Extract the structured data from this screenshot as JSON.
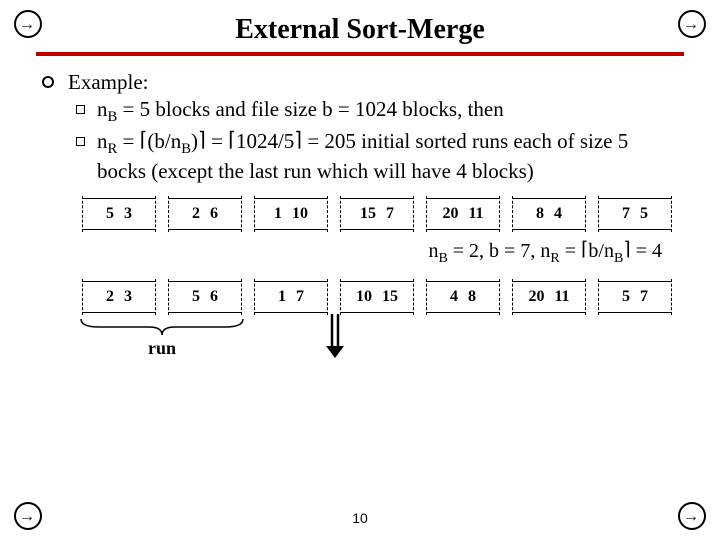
{
  "title": "External Sort-Merge",
  "page_number": "10",
  "example_label": "Example:",
  "bullet1_pre": "n",
  "bullet1_sub": "B",
  "bullet1_post": " = 5 blocks and file size b = 1024 blocks, then",
  "bullet2_nr_pre": "n",
  "bullet2_nr_sub": "R",
  "bullet2_eq1": " = ",
  "bullet2_frac_pre": "(b/n",
  "bullet2_frac_sub": "B",
  "bullet2_frac_post": ")",
  "bullet2_eq2": " = ",
  "bullet2_val": "1024/5",
  "bullet2_tail": " = 205 initial sorted runs each of size 5 bocks (except the last run which will have 4 blocks)",
  "ceil_l": "⌈",
  "ceil_r": "⌉",
  "row1": [
    [
      "5",
      "3"
    ],
    [
      "2",
      "6"
    ],
    [
      "1",
      "10"
    ],
    [
      "15",
      "7"
    ],
    [
      "20",
      "11"
    ],
    [
      "8",
      "4"
    ],
    [
      "7",
      "5"
    ]
  ],
  "row2": [
    [
      "2",
      "3"
    ],
    [
      "5",
      "6"
    ],
    [
      "1",
      "7"
    ],
    [
      "10",
      "15"
    ],
    [
      "4",
      "8"
    ],
    [
      "20",
      "11"
    ],
    [
      "5",
      "7"
    ]
  ],
  "eq_nb_pre": "n",
  "eq_nb_sub": "B",
  "eq_nb_val": " = 2, b = 7, n",
  "eq_nr_sub": "R",
  "eq_nr_eq": " = ",
  "eq_frac_pre": "b/n",
  "eq_frac_sub": "B",
  "eq_tail": " = 4",
  "run_label": "run"
}
